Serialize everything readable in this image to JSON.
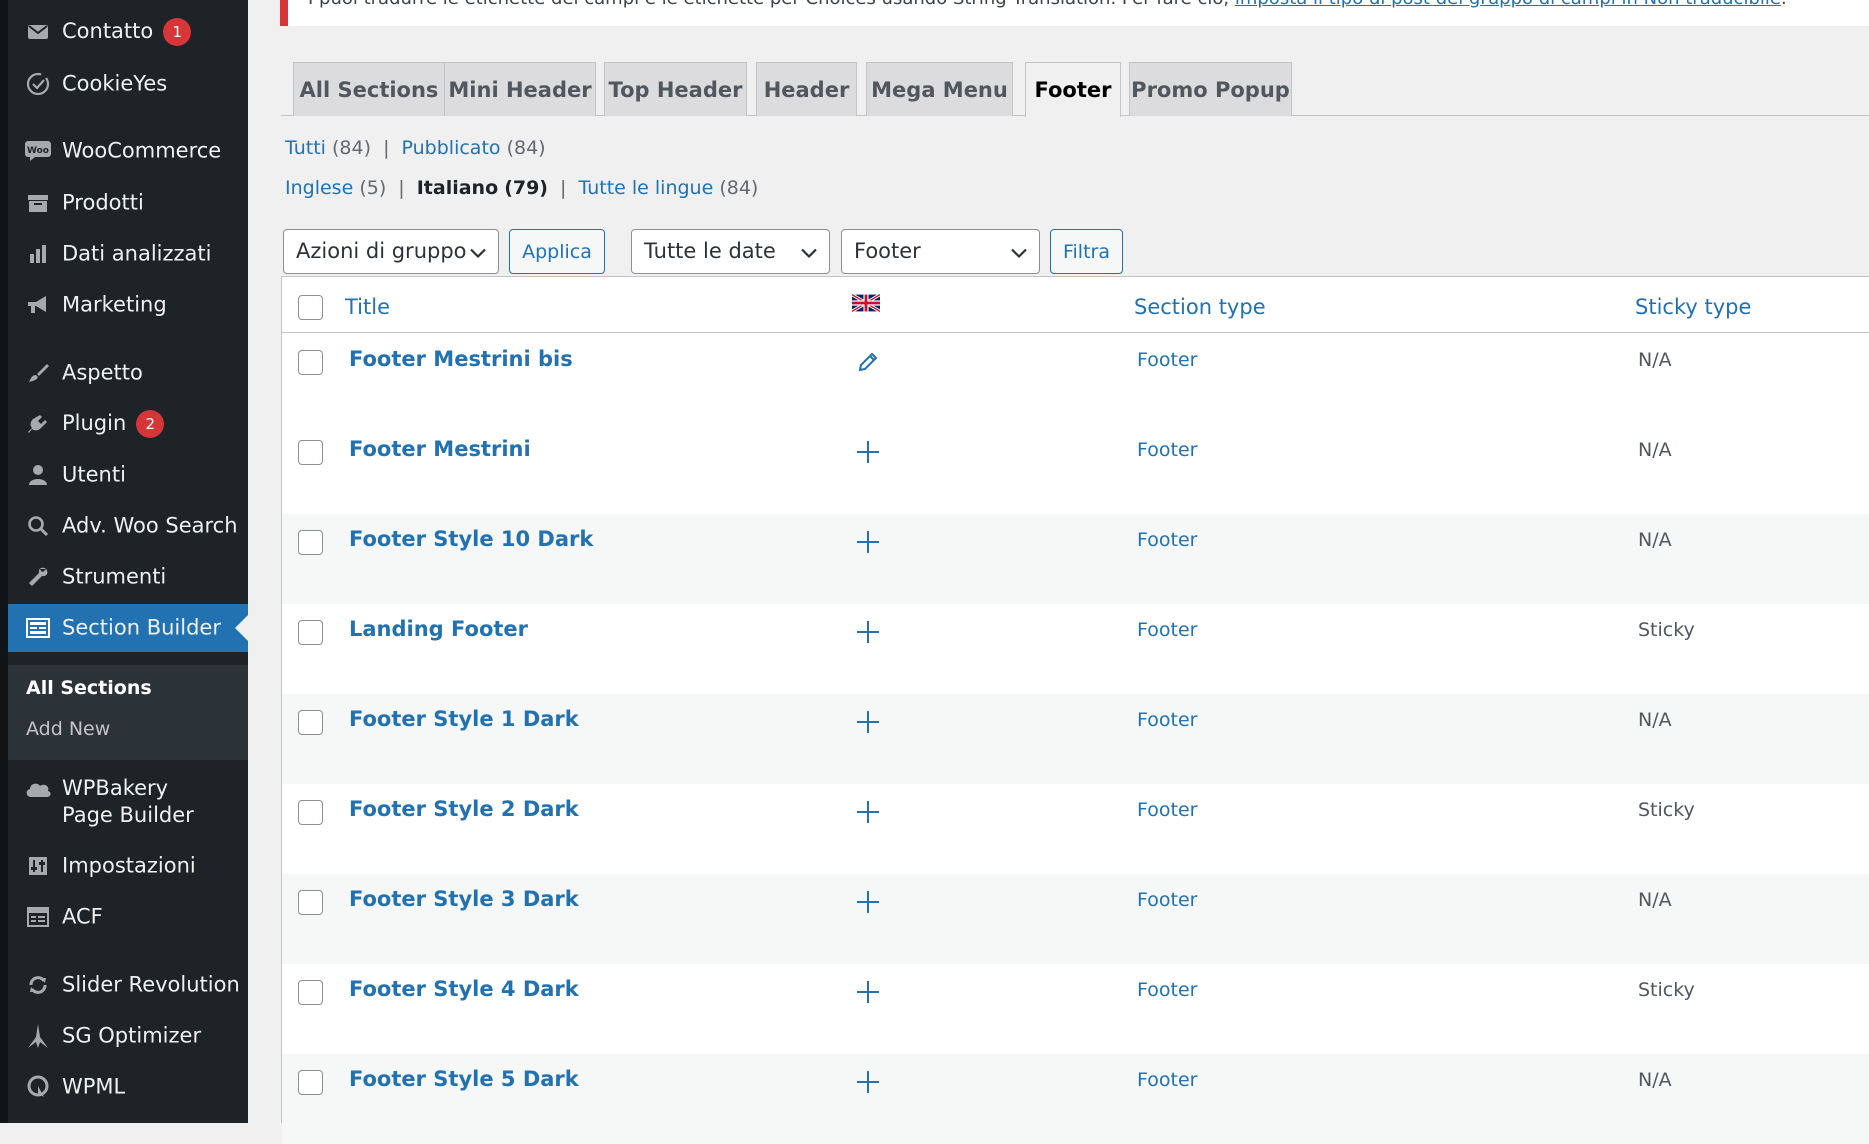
{
  "notice": {
    "text": "I puoi tradurre le etichette dei campi e le etichette per Choices usando String Translation. Per fare ciò, ",
    "link": "imposta il tipo di post del gruppo di campi in Non traducibile",
    "trail": "."
  },
  "sidebar": {
    "items": [
      {
        "label": "Contatto",
        "icon": "mail-icon",
        "badge": "1"
      },
      {
        "label": "CookieYes",
        "icon": "cookie-icon",
        "badge": ""
      },
      {
        "label": "WooCommerce",
        "icon": "woo-icon",
        "badge": ""
      },
      {
        "label": "Prodotti",
        "icon": "archive-icon",
        "badge": ""
      },
      {
        "label": "Dati analizzati",
        "icon": "chart-bar-icon",
        "badge": ""
      },
      {
        "label": "Marketing",
        "icon": "megaphone-icon",
        "badge": ""
      },
      {
        "label": "Aspetto",
        "icon": "brush-icon",
        "badge": ""
      },
      {
        "label": "Plugin",
        "icon": "plugin-icon",
        "badge": "2"
      },
      {
        "label": "Utenti",
        "icon": "user-icon",
        "badge": ""
      },
      {
        "label": "Adv. Woo Search",
        "icon": "search-icon",
        "badge": ""
      },
      {
        "label": "Strumenti",
        "icon": "wrench-icon",
        "badge": ""
      },
      {
        "label": "Section Builder",
        "icon": "layout-icon",
        "badge": ""
      },
      {
        "label": "WPBakery Page Builder",
        "icon": "cloud-icon",
        "badge": ""
      },
      {
        "label": "Impostazioni",
        "icon": "settings-icon",
        "badge": ""
      },
      {
        "label": "ACF",
        "icon": "table-icon",
        "badge": ""
      },
      {
        "label": "Slider Revolution",
        "icon": "refresh-icon",
        "badge": ""
      },
      {
        "label": "SG Optimizer",
        "icon": "sg-icon",
        "badge": ""
      },
      {
        "label": "WPML",
        "icon": "wpml-icon",
        "badge": ""
      }
    ],
    "submenu": {
      "all": "All Sections",
      "add": "Add New"
    }
  },
  "tabs": [
    "All Sections",
    "Mini Header",
    "Top Header",
    "Header",
    "Mega Menu",
    "Footer",
    "Promo Popup"
  ],
  "status_links": {
    "all": "Tutti",
    "all_count": "(84)",
    "published": "Pubblicato",
    "published_count": "(84)"
  },
  "lang_links": {
    "en": "Inglese",
    "en_count": "(5)",
    "it": "Italiano",
    "it_count": "(79)",
    "all": "Tutte le lingue",
    "all_count": "(84)"
  },
  "controls": {
    "bulk": "Azioni di gruppo",
    "apply": "Applica",
    "dates": "Tutte le date",
    "section": "Footer",
    "filter": "Filtra"
  },
  "table": {
    "columns": {
      "title": "Title",
      "flag": "uk-flag-icon",
      "section_type": "Section type",
      "sticky_type": "Sticky type"
    },
    "rows": [
      {
        "title": "Footer Mestrini bis",
        "action": "pencil-icon",
        "section_type": "Footer",
        "sticky": "N/A"
      },
      {
        "title": "Footer Mestrini",
        "action": "plus-icon",
        "section_type": "Footer",
        "sticky": "N/A"
      },
      {
        "title": "Footer Style 10 Dark",
        "action": "plus-icon",
        "section_type": "Footer",
        "sticky": "N/A"
      },
      {
        "title": "Landing Footer",
        "action": "plus-icon",
        "section_type": "Footer",
        "sticky": "Sticky"
      },
      {
        "title": "Footer Style 1 Dark",
        "action": "plus-icon",
        "section_type": "Footer",
        "sticky": "N/A"
      },
      {
        "title": "Footer Style 2 Dark",
        "action": "plus-icon",
        "section_type": "Footer",
        "sticky": "Sticky"
      },
      {
        "title": "Footer Style 3 Dark",
        "action": "plus-icon",
        "section_type": "Footer",
        "sticky": "N/A"
      },
      {
        "title": "Footer Style 4 Dark",
        "action": "plus-icon",
        "section_type": "Footer",
        "sticky": "Sticky"
      },
      {
        "title": "Footer Style 5 Dark",
        "action": "plus-icon",
        "section_type": "Footer",
        "sticky": "N/A"
      }
    ]
  },
  "colors": {
    "accent": "#2271b1",
    "sidebar": "#1d2327",
    "active": "#2271b1",
    "badge": "#d63638"
  }
}
